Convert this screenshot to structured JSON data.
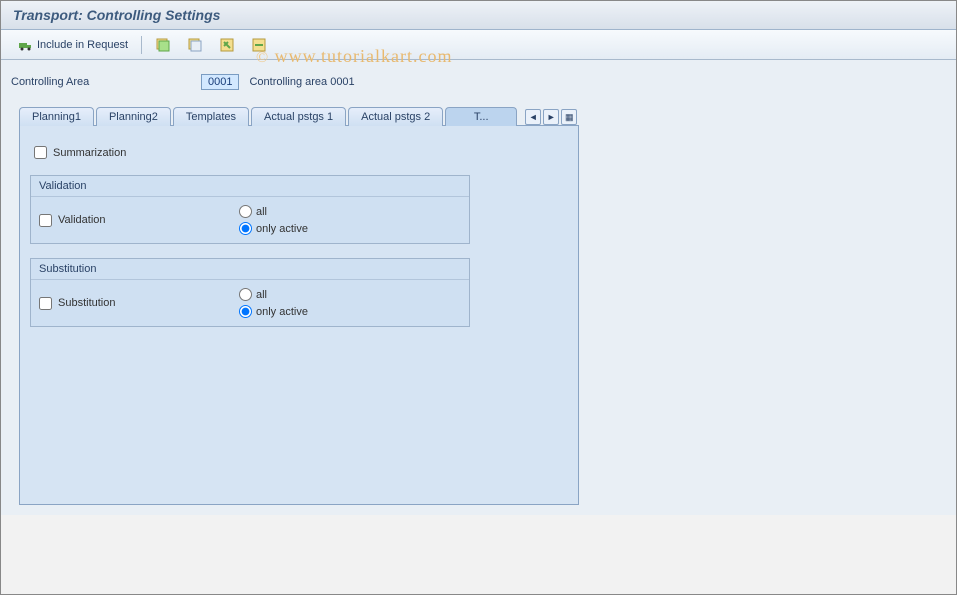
{
  "title": "Transport: Controlling Settings",
  "watermark": {
    "copy": "©",
    "text": "www.tutorialkart.com"
  },
  "toolbar": {
    "include_label": "Include in Request"
  },
  "field": {
    "label": "Controlling Area",
    "value": "0001",
    "desc": "Controlling area 0001"
  },
  "tabs": {
    "items": [
      {
        "label": "Planning1"
      },
      {
        "label": "Planning2"
      },
      {
        "label": "Templates"
      },
      {
        "label": "Actual pstgs 1"
      },
      {
        "label": "Actual pstgs 2"
      },
      {
        "label": "T..."
      }
    ]
  },
  "panel": {
    "summarization_label": "Summarization",
    "summarization_checked": false,
    "validation": {
      "title": "Validation",
      "checkbox_label": "Validation",
      "checkbox_checked": false,
      "opt_all": "all",
      "opt_active": "only active",
      "radio_selected": "only active"
    },
    "substitution": {
      "title": "Substitution",
      "checkbox_label": "Substitution",
      "checkbox_checked": false,
      "opt_all": "all",
      "opt_active": "only active",
      "radio_selected": "only active"
    }
  }
}
